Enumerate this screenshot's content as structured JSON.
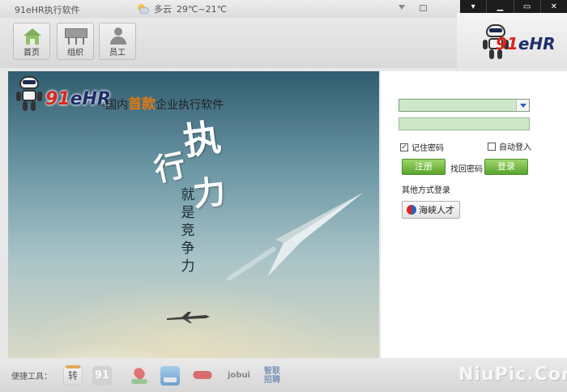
{
  "window": {
    "title": "91eHR执行软件",
    "weather": {
      "condition": "多云",
      "temperature": "29℃~21℃"
    }
  },
  "controls": {
    "menu": "▾",
    "minimize": "▁",
    "maximize": "▭",
    "close": "✕"
  },
  "toolbar": {
    "home_label": "首页",
    "org_label": "组织",
    "staff_label": "员工"
  },
  "logo": {
    "num": "91",
    "text": "eHR"
  },
  "banner": {
    "brand_num": "91",
    "brand_text": "eHR",
    "slogan_prefix": "--国内",
    "slogan_highlight": "首款",
    "slogan_suffix": "企业执行软件",
    "calli_1": "执",
    "calli_2": "行",
    "calli_3": "力",
    "vertical_slogan": [
      "就",
      "是",
      "竞",
      "争",
      "力"
    ]
  },
  "login": {
    "remember_label": "记住密码",
    "auto_label": "自动登入",
    "register_label": "注册",
    "find_password_label": "找回密码",
    "login_label": "登录",
    "other_login_label": "其他方式登录",
    "haixia_label": "海峡人才"
  },
  "bottombar": {
    "quick_tools_label": "便捷工具：",
    "zhuan": "转",
    "tool_91": "91",
    "jobui": "jobui",
    "zhilian": "智联招聘",
    "watermark": "NiuPic.Com"
  }
}
